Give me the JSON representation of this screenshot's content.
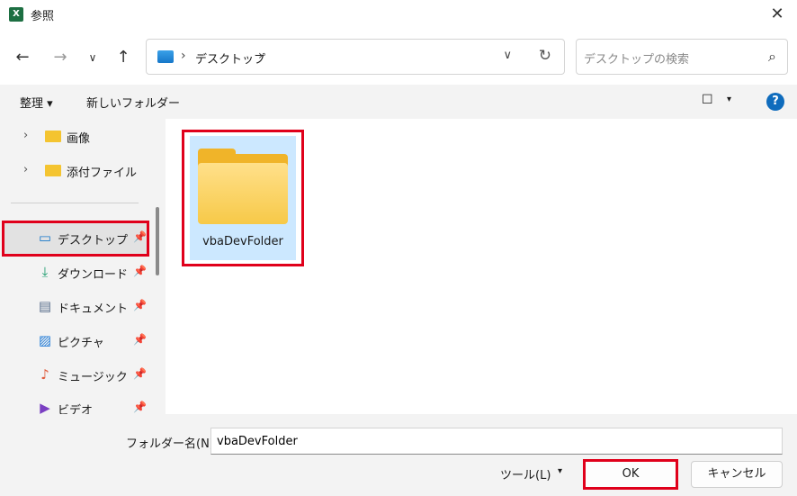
{
  "window": {
    "title": "参照",
    "app_icon": "excel-icon",
    "close_glyph": "✕"
  },
  "nav": {
    "back_glyph": "←",
    "forward_glyph": "→",
    "recent_glyph": "∨",
    "up_glyph": "↑",
    "address": {
      "location": "デスクトップ",
      "sep": "›"
    },
    "refresh_glyph": "↻",
    "dropdown_glyph": "∨",
    "search_placeholder": "デスクトップの検索",
    "search_glyph": "⌕"
  },
  "commandbar": {
    "organize_label": "整理 ▾",
    "new_folder_label": "新しいフォルダー",
    "view_glyph": "☐",
    "view_dd_glyph": "▾",
    "help_glyph": "?"
  },
  "sidebar": {
    "tree_items": [
      {
        "label": "画像",
        "chevron": "›",
        "icon": "folder-icon"
      },
      {
        "label": "添付ファイル",
        "chevron": "›",
        "icon": "folder-icon"
      }
    ],
    "quick_access": [
      {
        "label": "デスクトップ",
        "icon": "desktop-icon",
        "glyph": "▭",
        "pin": "📌"
      },
      {
        "label": "ダウンロード",
        "icon": "download-icon",
        "glyph": "⤓",
        "pin": "📌"
      },
      {
        "label": "ドキュメント",
        "icon": "document-icon",
        "glyph": "▤",
        "pin": "📌"
      },
      {
        "label": "ピクチャ",
        "icon": "pictures-icon",
        "glyph": "▨",
        "pin": "📌"
      },
      {
        "label": "ミュージック",
        "icon": "music-icon",
        "glyph": "♪",
        "pin": "📌"
      },
      {
        "label": "ビデオ",
        "icon": "video-icon",
        "glyph": "▶",
        "pin": "📌"
      }
    ]
  },
  "content": {
    "items": [
      {
        "name": "vbaDevFolder",
        "icon": "folder-icon"
      }
    ]
  },
  "footer": {
    "folder_name_label": "フォルダー名(N):",
    "folder_name_value": "vbaDevFolder",
    "tools_label": "ツール(L)",
    "tools_dd_glyph": "▾",
    "ok_label": "OK",
    "cancel_label": "キャンセル"
  },
  "colors": {
    "accent": "#0f6cbd",
    "highlight_red": "#e0001b",
    "selection": "#cce8ff",
    "folder": "#f7c948"
  }
}
